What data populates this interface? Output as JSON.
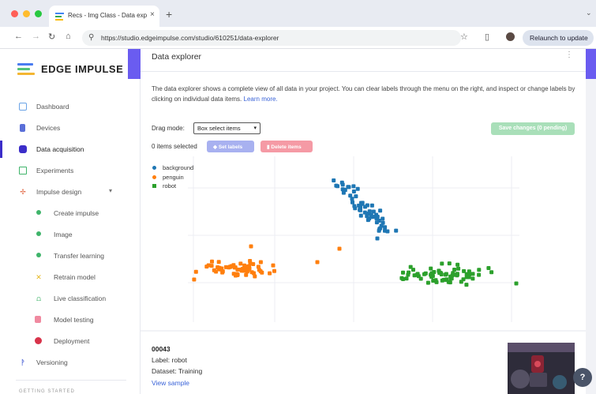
{
  "browser": {
    "tab_title": "Recs - Img Class - Data exp",
    "tab_close": "×",
    "new_tab": "+",
    "url": "https://studio.edgeimpulse.com/studio/610251/data-explorer",
    "relaunch_label": "Relaunch to update"
  },
  "sidebar": {
    "brand": "EDGE IMPULSE",
    "items": [
      {
        "label": "Dashboard",
        "icon": "dashboard-icon"
      },
      {
        "label": "Devices",
        "icon": "devices-icon"
      },
      {
        "label": "Data acquisition",
        "icon": "data-acquisition-icon"
      },
      {
        "label": "Experiments",
        "icon": "experiments-icon"
      },
      {
        "label": "Impulse design",
        "icon": "impulse-icon"
      },
      {
        "label": "Create impulse",
        "icon": "dot-icon"
      },
      {
        "label": "Image",
        "icon": "dot-icon"
      },
      {
        "label": "Transfer learning",
        "icon": "dot-icon"
      },
      {
        "label": "Retrain model",
        "icon": "retrain-icon"
      },
      {
        "label": "Live classification",
        "icon": "live-icon"
      },
      {
        "label": "Model testing",
        "icon": "testing-icon"
      },
      {
        "label": "Deployment",
        "icon": "deployment-icon"
      },
      {
        "label": "Versioning",
        "icon": "versioning-icon"
      }
    ],
    "footer": "GETTING STARTED"
  },
  "explorer": {
    "title": "Data explorer",
    "menu": "⋮",
    "description": "The data explorer shows a complete view of all data in your project. You can clear labels through the menu on the right, and inspect or change labels by clicking on individual data items.",
    "learn_more": "Learn more.",
    "drag_mode_label": "Drag mode:",
    "drag_mode_value": "Box select items",
    "save_label": "Save changes (0 pending)",
    "selected_label": "0 items selected",
    "set_labels": "Set labels",
    "delete_items": "Delete items",
    "colors": {
      "background": "#1f77b4",
      "penguin": "#ff7f0e",
      "robot": "#2ca02c"
    }
  },
  "chart_data": {
    "type": "scatter",
    "series": [
      {
        "name": "background",
        "color": "#1f77b4"
      },
      {
        "name": "penguin",
        "color": "#ff7f0e"
      },
      {
        "name": "robot",
        "color": "#2ca02c"
      }
    ]
  },
  "sample": {
    "id": "00043",
    "label": "Label: robot",
    "dataset": "Dataset: Training",
    "view": "View sample"
  },
  "help": "?"
}
